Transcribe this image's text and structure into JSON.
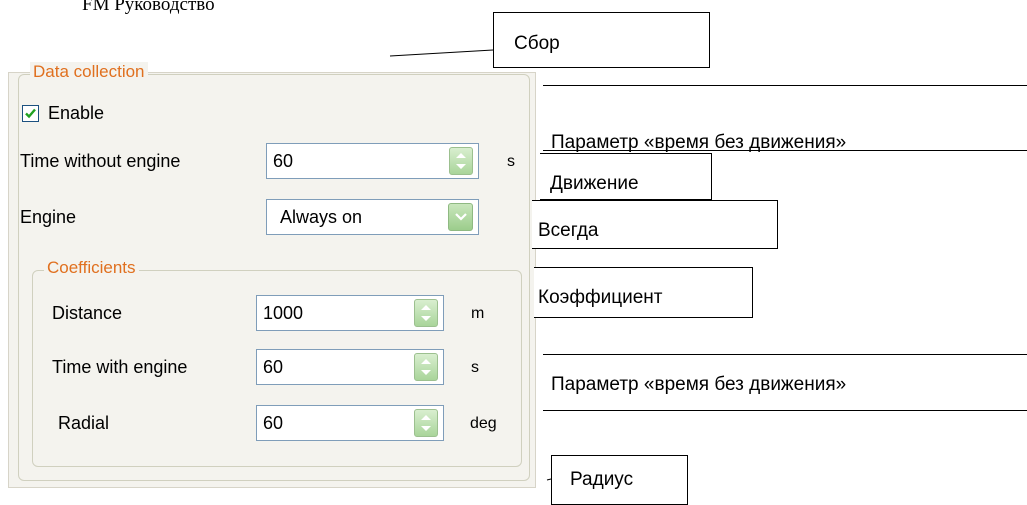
{
  "document": {
    "header": "FM Руководство"
  },
  "dialog": {
    "group_title": "Data collection",
    "enable": {
      "label": "Enable",
      "checked": true
    },
    "time_without_engine": {
      "label": "Time without engine",
      "value": "60",
      "unit": "s"
    },
    "engine": {
      "label": "Engine",
      "selected": "Always on"
    },
    "coefficients": {
      "title": "Coefficients",
      "distance": {
        "label": "Distance",
        "value": "1000",
        "unit": "m"
      },
      "time_with_engine": {
        "label": "Time with engine",
        "value": "60",
        "unit": "s"
      },
      "radial": {
        "label": "Radial",
        "value": "60",
        "unit": "deg"
      }
    }
  },
  "annotations": {
    "sbor": "Сбор",
    "param_time_1": "Параметр «время без движения»",
    "dvizhenie": "Движение",
    "vsegda": "Всегда",
    "koefficient": "Коэффициент",
    "param_time_2": "Параметр «время без движения»",
    "radius": "Радиус"
  },
  "colors": {
    "group_title": "#e0701f",
    "dialog_bg": "#f4f3ee",
    "spin_button": "#b9ddaa"
  }
}
